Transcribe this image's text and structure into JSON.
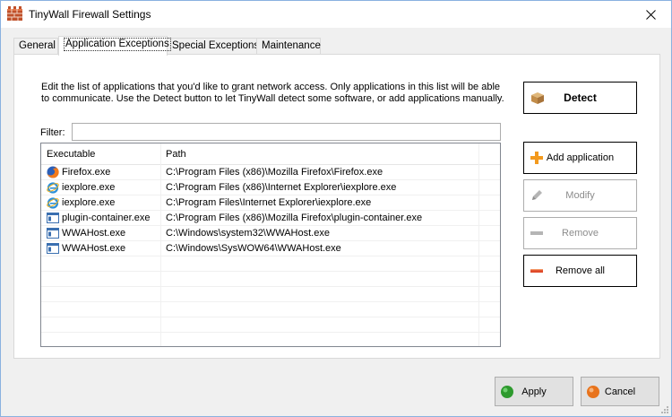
{
  "window": {
    "title": "TinyWall Firewall Settings",
    "app_icon": "firewall-brick-icon",
    "close_icon": "close-icon"
  },
  "tabs": [
    {
      "label": "General",
      "active": false
    },
    {
      "label": "Application Exceptions",
      "active": true
    },
    {
      "label": "Special Exceptions",
      "active": false
    },
    {
      "label": "Maintenance",
      "active": false
    }
  ],
  "main": {
    "description": "Edit the list of applications that you'd like to grant network access. Only applications in this list will be able to communicate. Use the Detect button to let TinyWall detect some software, or add applications manually.",
    "filter_label": "Filter:",
    "filter_value": "",
    "columns": {
      "executable": "Executable",
      "path": "Path"
    },
    "rows": [
      {
        "exe": "Firefox.exe",
        "path": "C:\\Program Files (x86)\\Mozilla Firefox\\Firefox.exe",
        "icon": "firefox-icon"
      },
      {
        "exe": "iexplore.exe",
        "path": "C:\\Program Files (x86)\\Internet Explorer\\iexplore.exe",
        "icon": "internet-explorer-icon"
      },
      {
        "exe": "iexplore.exe",
        "path": "C:\\Program Files\\Internet Explorer\\iexplore.exe",
        "icon": "internet-explorer-icon"
      },
      {
        "exe": "plugin-container.exe",
        "path": "C:\\Program Files (x86)\\Mozilla Firefox\\plugin-container.exe",
        "icon": "window-app-icon"
      },
      {
        "exe": "WWAHost.exe",
        "path": "C:\\Windows\\system32\\WWAHost.exe",
        "icon": "window-app-icon"
      },
      {
        "exe": "WWAHost.exe",
        "path": "C:\\Windows\\SysWOW64\\WWAHost.exe",
        "icon": "window-app-icon"
      }
    ]
  },
  "side_buttons": {
    "detect": "Detect",
    "add": "Add application",
    "modify": "Modify",
    "remove": "Remove",
    "remove_all": "Remove all"
  },
  "footer": {
    "apply": "Apply",
    "cancel": "Cancel"
  },
  "colors": {
    "window_border": "#8ab1e0",
    "apply_icon": "#2e9a2e",
    "cancel_icon": "#e8731c",
    "add_icon": "#f39a1e",
    "remove_all_icon": "#e04a2a"
  }
}
